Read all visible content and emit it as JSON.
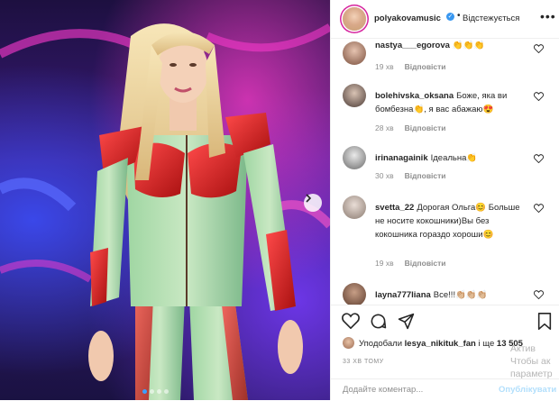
{
  "header": {
    "username": "polyakovamusic",
    "verified_mark": "✓",
    "separator": "•",
    "follow_status": "Відстежується",
    "more": "•••"
  },
  "comments": [
    {
      "user": "nastya___egorova",
      "text": "👏👏👏",
      "time": "19 хв",
      "reply": "Відповісти"
    },
    {
      "user": "bolehivska_oksana",
      "text": "Боже, яка ви бомбезна👏, я вас абажаю😍",
      "time": "28 хв",
      "reply": "Відповісти"
    },
    {
      "user": "irinanagainik",
      "text": "Ідеальна👏",
      "time": "30 хв",
      "reply": "Відповісти"
    },
    {
      "user": "svetta_22",
      "text": "Дорогая Ольга😊 Больше не носите кокошники)Вы без кокошника гораздо хороши😊",
      "time": "19 хв",
      "reply": "Відповісти"
    },
    {
      "user": "layna777liana",
      "text": "Все!!!👏🏼👏🏼👏🏼",
      "time": "",
      "reply": ""
    }
  ],
  "likes": {
    "prefix": "Уподобали",
    "user": "lesya_nikituk_fan",
    "suffix": "і ще",
    "count": "13 505"
  },
  "time_ago": "33 ХВ ТОМУ",
  "add_comment": {
    "placeholder": "Додайте коментар...",
    "post_label": "Опублікувати"
  },
  "watermark": [
    "Актив",
    "Чтобы ак",
    "параметр"
  ],
  "icons": [
    "next-arrow-icon",
    "heart-icon",
    "comment-icon",
    "share-icon",
    "bookmark-icon",
    "verified-icon",
    "more-icon"
  ],
  "colors": {
    "accent": "#3897f0",
    "post_disabled": "#b2dffc",
    "muted": "#8e8e8e"
  }
}
